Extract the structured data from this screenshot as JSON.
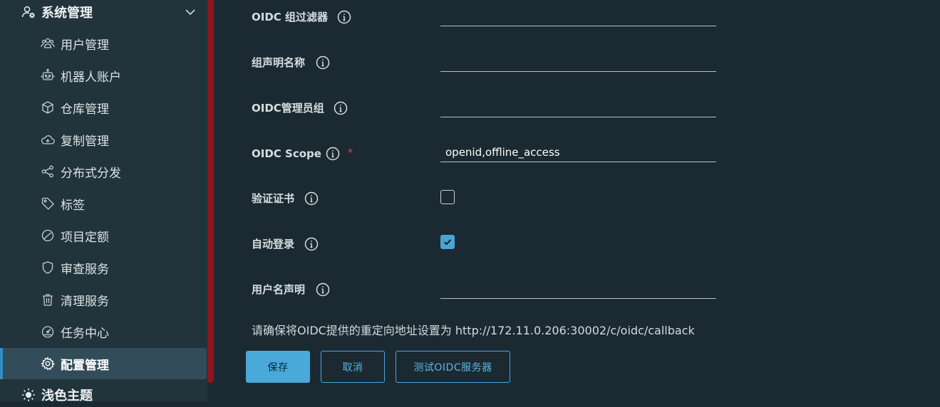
{
  "sidebar": {
    "group_system": {
      "label": "系统管理",
      "icon": "user-settings-icon"
    },
    "items": [
      {
        "label": "用户管理",
        "icon": "users-icon"
      },
      {
        "label": "机器人账户",
        "icon": "robot-icon"
      },
      {
        "label": "仓库管理",
        "icon": "box-icon"
      },
      {
        "label": "复制管理",
        "icon": "cloud-icon"
      },
      {
        "label": "分布式分发",
        "icon": "share-icon"
      },
      {
        "label": "标签",
        "icon": "tag-icon"
      },
      {
        "label": "项目定额",
        "icon": "pie-icon"
      },
      {
        "label": "审查服务",
        "icon": "shield-icon"
      },
      {
        "label": "清理服务",
        "icon": "trash-icon"
      },
      {
        "label": "任务中心",
        "icon": "dashboard-icon"
      },
      {
        "label": "配置管理",
        "icon": "gear-icon",
        "active": true
      }
    ],
    "group_theme": {
      "label": "浅色主题",
      "icon": "sun-icon"
    }
  },
  "form": {
    "group_filter": {
      "label": "OIDC 组过滤器",
      "value": ""
    },
    "group_claim": {
      "label": "组声明名称",
      "value": ""
    },
    "admin_group": {
      "label": "OIDC管理员组",
      "value": ""
    },
    "scope": {
      "label": "OIDC Scope",
      "required": "*",
      "value": "openid,offline_access"
    },
    "verify_cert": {
      "label": "验证证书",
      "checked": false
    },
    "auto_onboard": {
      "label": "自动登录",
      "checked": true
    },
    "username_claim": {
      "label": "用户名声明",
      "value": ""
    }
  },
  "note": "请确保将OIDC提供的重定向地址设置为 http://172.11.0.206:30002/c/oidc/callback",
  "buttons": {
    "save": "保存",
    "cancel": "取消",
    "test": "测试OIDC服务器"
  },
  "colors": {
    "background": "#1b2a32",
    "sidebar": "#21333b",
    "accent": "#49a9d8",
    "active_item": "#324c5a",
    "scrollbar": "#8a1620",
    "required": "#e0484b"
  }
}
